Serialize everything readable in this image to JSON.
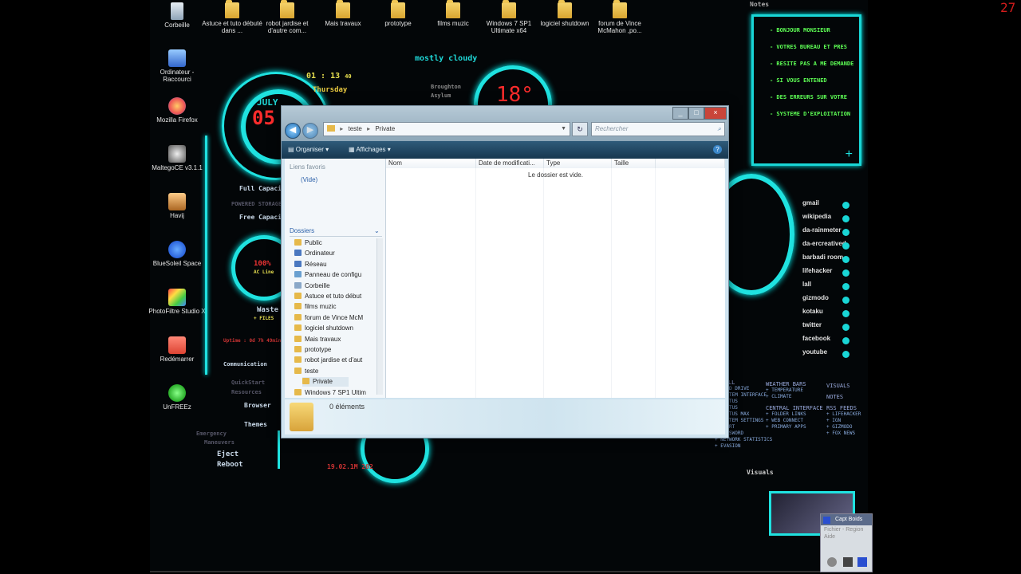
{
  "desktop": {
    "top_icons": [
      {
        "label": "Corbeille",
        "icon": "recycle-bin-icon"
      },
      {
        "label": "Astuce et tuto débuté dans ...",
        "icon": "folder-icon"
      },
      {
        "label": "robot jardise et d'autre com...",
        "icon": "folder-icon"
      },
      {
        "label": "Mais travaux",
        "icon": "folder-icon"
      },
      {
        "label": "prototype",
        "icon": "folder-icon"
      },
      {
        "label": "films muzic",
        "icon": "folder-icon"
      },
      {
        "label": "Windows 7 SP1 Ultimate x64",
        "icon": "folder-icon"
      },
      {
        "label": "logiciel shutdown",
        "icon": "folder-icon"
      },
      {
        "label": "forum de Vince McMahon ,po...",
        "icon": "folder-icon"
      }
    ],
    "left_icons": [
      {
        "label": "Ordinateur - Raccourci",
        "icon": "computer-icon"
      },
      {
        "label": "Mozilla Firefox",
        "icon": "firefox-icon"
      },
      {
        "label": "MaltegoCE v3.1.1",
        "icon": "maltego-icon"
      },
      {
        "label": "Havij",
        "icon": "havij-icon"
      },
      {
        "label": "BlueSoleil Space",
        "icon": "bluetooth-icon"
      },
      {
        "label": "PhotoFiltre Studio X",
        "icon": "photofiltre-icon"
      },
      {
        "label": "Redémarrer",
        "icon": "restart-icon"
      },
      {
        "label": "UnFREEz",
        "icon": "unfreez-icon"
      }
    ]
  },
  "hud": {
    "weather": "mostly cloudy",
    "weather_sub1": "Broughton",
    "weather_sub2": "Asylum",
    "temperature": "18°",
    "month": "JULY",
    "day_num": "05",
    "time": "01 : 13",
    "seconds": "40",
    "weekday": "Thursday",
    "corner_clock": "27",
    "full_capacity": "Full Capacity",
    "powered_storage": "POWERED STORAGE",
    "free_capacity": "Free Capacity",
    "battery_pct": "100%",
    "battery_sub": "AC Line",
    "waste": "Waste",
    "files": "+ FILES",
    "uptime": "Uptime : 0d 7h 49min",
    "communication": "Communication",
    "quickstart": "QuickStart",
    "resources": "Resources",
    "browser": "Browser",
    "themes": "Themes",
    "emergency": "Emergency",
    "maneuvers": "Maneuvers",
    "eject": "Eject",
    "reboot": "Reboot",
    "bottom_date": "19.02.1M 202",
    "notes_title": "Notes",
    "notes_lines": [
      "- BONJOUR MONSIEUR",
      "- VOTRES BUREAU ET PRES",
      "- RESITE PAS A ME DEMANDE",
      "- SI VOUS ENTENED",
      "- DES ERREURS SUR VOTRE",
      "- SYSTEME D'EXPLOITATION"
    ],
    "notes_add": "+",
    "links": [
      "gmail",
      "wikipedia",
      "da-rainmeter",
      "da-ercreatived",
      "barbadi room",
      "lifehacker",
      "lall",
      "gizmodo",
      "kotaku",
      "twitter",
      "facebook",
      "youtube"
    ],
    "panel_label": "Visuals",
    "panel_col1": [
      "PANELL",
      "+ HARD DRIVE",
      "+ SYSTEM INTERFACE",
      "+ STATUS",
      "+ STATUS",
      "+ STATUS MAX",
      "+ SYSTEM SETTINGS",
      "+ START",
      "+ PASSWORD",
      "+ NETWORK STATISTICS",
      "+ EVASION"
    ],
    "panel_col2": [
      "WEATHER BARS",
      "+ TEMPERATURE",
      "+ CLIMATE",
      "CENTRAL INTERFACE",
      "+ FOLDER LINKS",
      "+ WEB CONNECT",
      "+ PRIMARY APPS"
    ],
    "panel_col3": [
      "VISUALS",
      "NOTES",
      "RSS FEEDS",
      "+ LIFEHACKER",
      "+ IGN",
      "+ GIZMODO",
      "+ FOX NEWS"
    ]
  },
  "explorer": {
    "path_parts": [
      "teste",
      "Private"
    ],
    "search_placeholder": "Rechercher",
    "toolbar": {
      "organize": "Organiser",
      "views": "Affichages"
    },
    "favorites_title": "Liens favoris",
    "favorites_empty": "(Vide)",
    "folders_title": "Dossiers",
    "tree": [
      "Public",
      "Ordinateur",
      "Réseau",
      "Panneau de configu",
      "Corbeille",
      "Astuce et tuto début",
      "films muzic",
      "forum de Vince McM",
      "logiciel shutdown",
      "Mais travaux",
      "prototype",
      "robot jardise et d'aut",
      "teste",
      "Private",
      "Windows 7 SP1 Ultim"
    ],
    "columns": [
      "Nom",
      "Date de modificati...",
      "Type",
      "Taille"
    ],
    "empty_message": "Le dossier est vide.",
    "item_count": "0 éléments",
    "minimize": "_",
    "maximize": "□",
    "close": "×"
  },
  "mini_window": {
    "title": "Capt Boids",
    "menu1": "Fichier",
    "menu2": "Region",
    "menu3": "Aide"
  },
  "colors": {
    "neon": "#1fe2e0",
    "notes_text": "#5eff55",
    "corner_clock": "#d21c1c"
  }
}
